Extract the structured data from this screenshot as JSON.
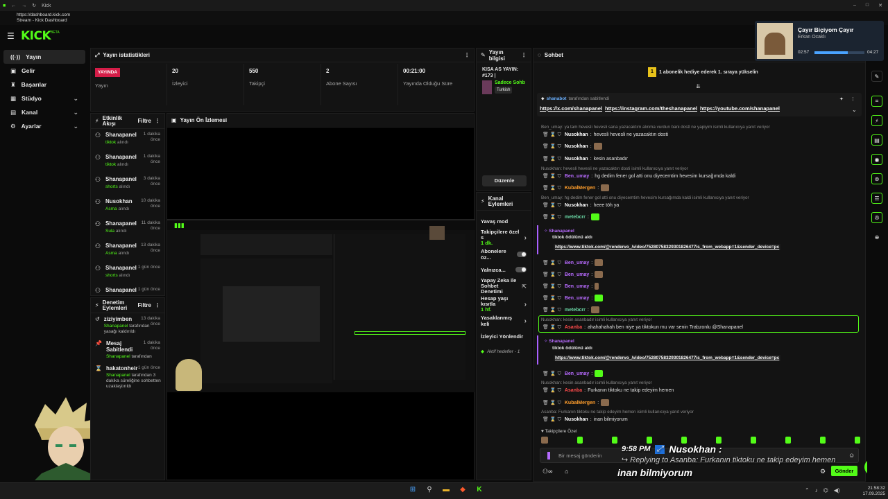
{
  "browser": {
    "tab_title": "Kick",
    "url": "https://dashboard.kick.com",
    "page_title": "Stream - Kick Dashboard"
  },
  "brand": {
    "logo": "KICK",
    "logo_sup": "BETA",
    "accent": "#53fc18"
  },
  "sidebar": {
    "items": [
      {
        "label": "Yayın",
        "icon": "broadcast-icon",
        "active": true
      },
      {
        "label": "Gelir",
        "icon": "wallet-icon"
      },
      {
        "label": "Başarılar",
        "icon": "trophy-icon"
      },
      {
        "label": "Stüdyo",
        "icon": "studio-icon",
        "expandable": true
      },
      {
        "label": "Kanal",
        "icon": "channel-icon",
        "expandable": true
      },
      {
        "label": "Ayarlar",
        "icon": "gear-icon",
        "expandable": true
      }
    ]
  },
  "stats": {
    "title": "Yayın istatistikleri",
    "live_badge": "YAYINDA",
    "live_label": "Yayın",
    "items": [
      {
        "value": "20",
        "label": "İzleyici"
      },
      {
        "value": "550",
        "label": "Takipçi"
      },
      {
        "value": "2",
        "label": "Abone Sayısı"
      },
      {
        "value": "00:21:00",
        "label": "Yayında Olduğu Süre"
      }
    ]
  },
  "stream_info": {
    "title": "Yayın bilgisi",
    "stream_title": "KISA AS YAYIN: #173 |",
    "category": "Sadece Sohb",
    "language": "Turkish",
    "edit_button": "Düzenle"
  },
  "activity": {
    "title": "Etkinlik Akışı",
    "filter": "Filtre",
    "items": [
      {
        "name": "Shanapanel",
        "sub": "tiktok",
        "sub_suffix": "alındı",
        "time": "1 dakika önce"
      },
      {
        "name": "Shanapanel",
        "sub": "tiktok",
        "sub_suffix": "alındı",
        "time": "1 dakika önce"
      },
      {
        "name": "Shanapanel",
        "sub": "shorts",
        "sub_suffix": "alındı",
        "time": "3 dakika önce"
      },
      {
        "name": "Nusokhan",
        "sub": "Asma",
        "sub_suffix": "alındı",
        "time": "10 dakika önce"
      },
      {
        "name": "Shanapanel",
        "sub": "Sula",
        "sub_suffix": "alındı",
        "time": "11 dakika önce"
      },
      {
        "name": "Shanapanel",
        "sub": "Asma",
        "sub_suffix": "alındı",
        "time": "13 dakika önce"
      },
      {
        "name": "Shanapanel",
        "sub": "shorts",
        "sub_suffix": "alındı",
        "time": "1 gün önce"
      },
      {
        "name": "Shanapanel",
        "sub": "",
        "sub_suffix": "",
        "time": "1 gün önce"
      }
    ]
  },
  "mod_actions": {
    "title": "Denetim Eylemleri",
    "filter": "Filtre",
    "items": [
      {
        "name": "ziziyimben",
        "actor": "Shanapanel",
        "text": "tarafından yasağı kaldırıldı",
        "time": "13 dakika önce"
      },
      {
        "name": "Mesaj Sabitlendi",
        "actor": "Shanapanel",
        "text": "tarafından",
        "time": "1 dakika önce"
      },
      {
        "name": "hakatonheir",
        "actor": "Shanapanel",
        "text": "tarafından 3 dakika süreliğine sohbetten uzaklaştırıldı",
        "time": "1 gün önce"
      }
    ]
  },
  "preview": {
    "title": "Yayın Ön İzlemesi"
  },
  "channel_actions": {
    "title": "Kanal Eylemleri",
    "items": [
      {
        "label": "Yavaş mod",
        "type": "none"
      },
      {
        "label": "Takipçilere özel s",
        "sub": "1 dk.",
        "type": "chevron"
      },
      {
        "label": "Abonelere öz...",
        "type": "toggle"
      },
      {
        "label": "Yalnızca...",
        "type": "toggle"
      },
      {
        "label": "Yapay Zeka ile Sohbet Denetimi",
        "type": "external"
      },
      {
        "label": "Hesap yaşı kısıtla",
        "sub": "1 hf.",
        "type": "chevron"
      },
      {
        "label": "Yasaklanmış keli",
        "type": "chevron"
      },
      {
        "label": "İzleyici Yönlendir",
        "type": "none"
      }
    ],
    "goals": "Aktif hedefler - 1"
  },
  "chat": {
    "title": "Sohbet",
    "gift_banner": "1 abonelik hediye ederek 1. sıraya yükselin",
    "pinned_by": "shanabot",
    "pinned_by_suffix": "tarafından sabitlendi",
    "pinned_links": [
      "https://x.com/shanapanel",
      "https://instagram.com/theshanapanel",
      "https://youtube.com/shanapanel"
    ],
    "reply_1": "Ben_umay: ya tam hevesli hevesli sana yazacaktım alınma vurdun bani dostl ne yapiyim isimli kullanıcıya yanıt veriyor",
    "msg_1_user": "Nusokhan",
    "msg_1_text": "hevesli hevesli ne yazacaktın dosti",
    "msg_2_user": "Nusokhan",
    "msg_3_user": "Nusokhan",
    "msg_3_text": "kesin asanbadır",
    "reply_2": "Nusokhan: hevesli hevesli ne yazacaktın dosti isimli kullanıcıya yanıt veriyor",
    "msg_4_user": "Ben_umay",
    "msg_4_text": "hg dedim fener gol atti onu diyecemtim hevesim kursağımda kaldi",
    "msg_5_user": "KubalMergen",
    "reply_3": "Ben_umay: hg dedim fener gol atti onu diyecemtim hevesim kursağımda kaldi isimli kullanıcıya yanıt veriyor",
    "msg_6_user": "Nusokhan",
    "msg_6_text": "heee töh ya",
    "msg_7_user": "metebcrr",
    "event_1_user": "Shanapanel",
    "event_1_text": "tiktok ödülünü aldı",
    "event_1_link": "https://www.tiktok.com/@rendervo_/video/75280758329301826477is_from_webapp=1&sender_device=pc",
    "msg_8_user": "Ben_umay",
    "msg_9_user": "Ben_umay",
    "msg_10_user": "Ben_umay",
    "msg_11_user": "Ben_umay",
    "msg_12_user": "metebcrr",
    "reply_4": "Nusokhan: kesin asanbadır isimli kullanıcıya yanıt veriyor",
    "msg_13_user": "Asanba",
    "msg_13_text": "ahahahahah ben niye ya tiktokun mu var senin Trabzonlu @Shanapanel",
    "event_2_user": "Shanapanel",
    "event_2_text": "tiktok ödülünü aldı",
    "event_2_link": "https://www.tiktok.com/@rendervo_/video/75280758329301826477is_from_webapp=1&sender_device=pc",
    "msg_14_user": "Ben_umay",
    "reply_5": "Nusokhan: kesin asanbadır isimli kullanıcıya yanıt veriyor",
    "msg_15_user": "Asanba",
    "msg_15_text": "Furkanın tiktoku ne takip edeyim hemen",
    "msg_16_user": "KubalMergen",
    "reply_6": "Asanba: Furkanın tiktoku ne takip edeyim hemen isimli kullanıcıya yanıt veriyor",
    "msg_17_user": "Nusokhan",
    "msg_17_text": "inan bilmiyorum",
    "followers_only": "Takipçilere Özel",
    "input_placeholder": "Bir mesaj gönderin",
    "send_button": "Gönder"
  },
  "overlay": {
    "time": "9:58 PM",
    "user": "Nusokhan :",
    "reply": "Replying to Asanba: Furkanın tiktoku ne takip edeyim hemen",
    "message": "inan bilmiyorum"
  },
  "media": {
    "title": "Çayır Biçiyom Çayır",
    "artist": "Erkan Ocaklı",
    "elapsed": "02:57",
    "duration": "04:27",
    "progress": 0.66
  },
  "taskbar": {
    "time": "21:58:32",
    "date": "17.09.2025"
  }
}
